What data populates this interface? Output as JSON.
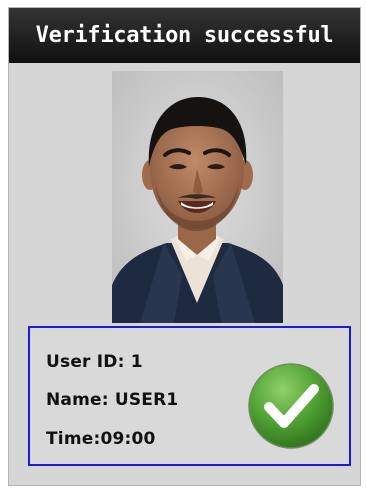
{
  "header": {
    "title": "Verification successful"
  },
  "photo": {
    "icon": "user-face-photo",
    "background_color": "#cfcfcf"
  },
  "result": {
    "user_id_text": "User ID: 1",
    "name_text": "Name: USER1",
    "time_text": "Time:09:00",
    "status_icon": "checkmark-icon",
    "status_color": "#4fa132",
    "border_color": "#1a1ae6"
  },
  "colors": {
    "screen_background": "#d6d6d6",
    "title_bar": "#141414",
    "title_text": "#ffffff"
  }
}
